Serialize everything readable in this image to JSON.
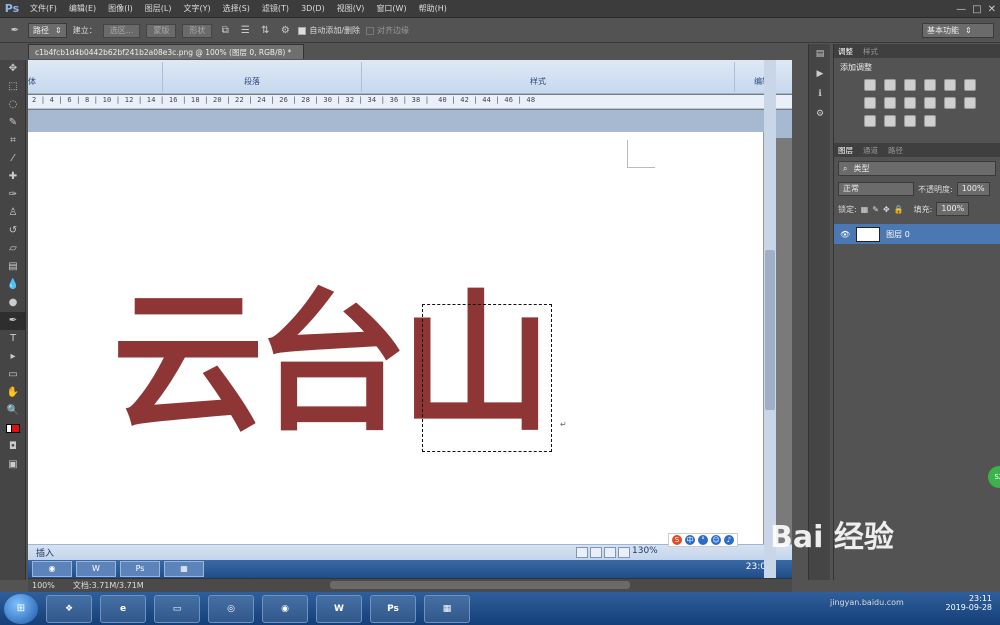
{
  "menubar": {
    "logo": "Ps",
    "items": [
      "文件(F)",
      "编辑(E)",
      "图像(I)",
      "图层(L)",
      "文字(Y)",
      "选择(S)",
      "滤镜(T)",
      "3D(D)",
      "视图(V)",
      "窗口(W)",
      "帮助(H)"
    ],
    "controls": [
      "—",
      "□",
      "✕"
    ]
  },
  "options": {
    "mode": "路径",
    "create_label": "建立：",
    "selection_btn": "选区...",
    "mask_btn": "蒙版",
    "shape_btn": "形状",
    "auto_add_label": "自动添加/删除",
    "align_edges_label": "对齐边缘",
    "workspace": "基本功能"
  },
  "document": {
    "tab_title": "c1b4fcb1d4b0442b62bf241b2a08e3c.png @ 100% (图层 0, RGB/8) *",
    "heading": "云台山",
    "color": "#8e3535"
  },
  "word": {
    "groups": [
      "体",
      "段落",
      "样式",
      "编辑"
    ],
    "ruler": "2 | 4 | 6 | 8 | 10 | 12 | 14 | 16 | 18 | 20 | 22 | 24 | 26 | 28 | 30 | 32 | 34 | 36 | 38 |  40 | 42 | 44 | 46 | 48",
    "status_mode": "插入",
    "zoom": "130%",
    "time": "23:0"
  },
  "ps_status": {
    "zoom": "100%",
    "doc_size": "文档:3.71M/3.71M"
  },
  "panels": {
    "top_tabs": [
      "调整",
      "样式"
    ],
    "adjust_title": "添加调整",
    "layer_tabs": [
      "图层",
      "通道",
      "路径"
    ],
    "filter_label": "类型",
    "blend_mode": "正常",
    "opacity_label": "不透明度:",
    "opacity": "100%",
    "lock_label": "锁定:",
    "fill_label": "填充:",
    "fill": "100%",
    "layer_name": "图层 0"
  },
  "taskbar": {
    "apps": [
      "e",
      "W",
      "Ps"
    ],
    "time": "23:11",
    "date": "2019-09-28"
  },
  "watermark": {
    "text": "Bai 经验",
    "url": "jingyan.baidu.com"
  }
}
